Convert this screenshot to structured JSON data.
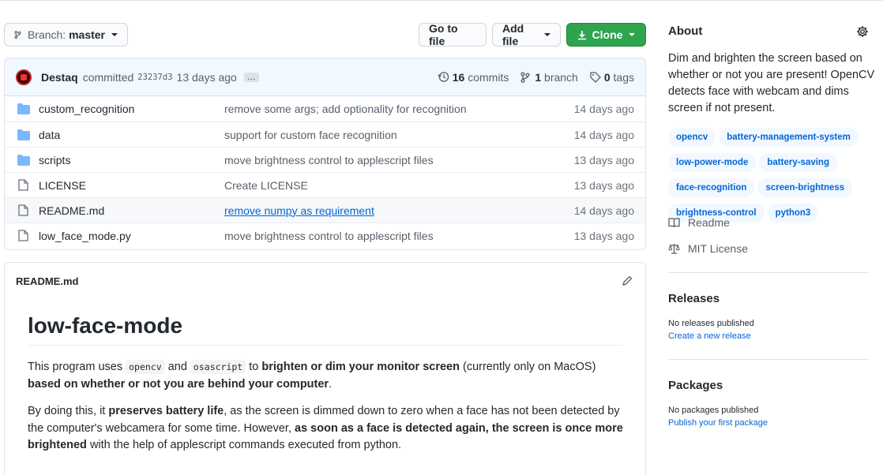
{
  "toolbar": {
    "branch_prefix": "Branch:",
    "branch_name": "master",
    "go_to_file": "Go to file",
    "add_file": "Add file",
    "clone": "Clone"
  },
  "commit": {
    "author": "Destaq",
    "action": "committed",
    "hash": "23237d3",
    "age": "13 days ago",
    "ellipsis": "…",
    "commits_count": "16",
    "commits_label": "commits",
    "branch_count": "1",
    "branch_label": "branch",
    "tags_count": "0",
    "tags_label": "tags"
  },
  "files": [
    {
      "type": "folder",
      "name": "custom_recognition",
      "message": "remove some args; add optionality for recognition",
      "age": "14 days ago"
    },
    {
      "type": "folder",
      "name": "data",
      "message": "support for custom face recognition",
      "age": "14 days ago"
    },
    {
      "type": "folder",
      "name": "scripts",
      "message": "move brightness control to applescript files",
      "age": "13 days ago"
    },
    {
      "type": "file",
      "name": "LICENSE",
      "message": "Create LICENSE",
      "age": "13 days ago"
    },
    {
      "type": "file",
      "name": "README.md",
      "message": "remove numpy as requirement",
      "age": "14 days ago"
    },
    {
      "type": "file",
      "name": "low_face_mode.py",
      "message": "move brightness control to applescript files",
      "age": "13 days ago"
    }
  ],
  "readme": {
    "file_label": "README.md",
    "title": "low-face-mode",
    "p1": {
      "t1": "This program uses",
      "code1": "opencv",
      "t2": "and",
      "code2": "osascript",
      "t3": "to",
      "b1": "brighten or dim your monitor screen",
      "t4": "(currently only on MacOS)",
      "b2": "based on whether or not you are behind your computer",
      "t5": "."
    },
    "p2": {
      "t1": "By doing this, it",
      "b1": "preserves battery life",
      "t2": ", as the screen is dimmed down to zero when a face has not been detected by the computer's webcamera for some time. However,",
      "b2": "as soon as a face is detected again, the screen is once more brightened",
      "t3": "with the help of applescript commands executed from python."
    }
  },
  "about": {
    "heading": "About",
    "description": "Dim and brighten the screen based on whether or not you are present! OpenCV detects face with webcam and dims screen if not present.",
    "topics": [
      "opencv",
      "battery-management-system",
      "low-power-mode",
      "battery-saving",
      "face-recognition",
      "screen-brightness",
      "brightness-control",
      "python3"
    ],
    "readme_link": "Readme",
    "license_link": "MIT License"
  },
  "releases": {
    "heading": "Releases",
    "status": "No releases published",
    "link": "Create a new release"
  },
  "packages": {
    "heading": "Packages",
    "status": "No packages published",
    "link": "Publish your first package"
  },
  "colors": {
    "accent": "#0366d6",
    "green": "#2ea44f",
    "folder": "#79b8ff"
  }
}
